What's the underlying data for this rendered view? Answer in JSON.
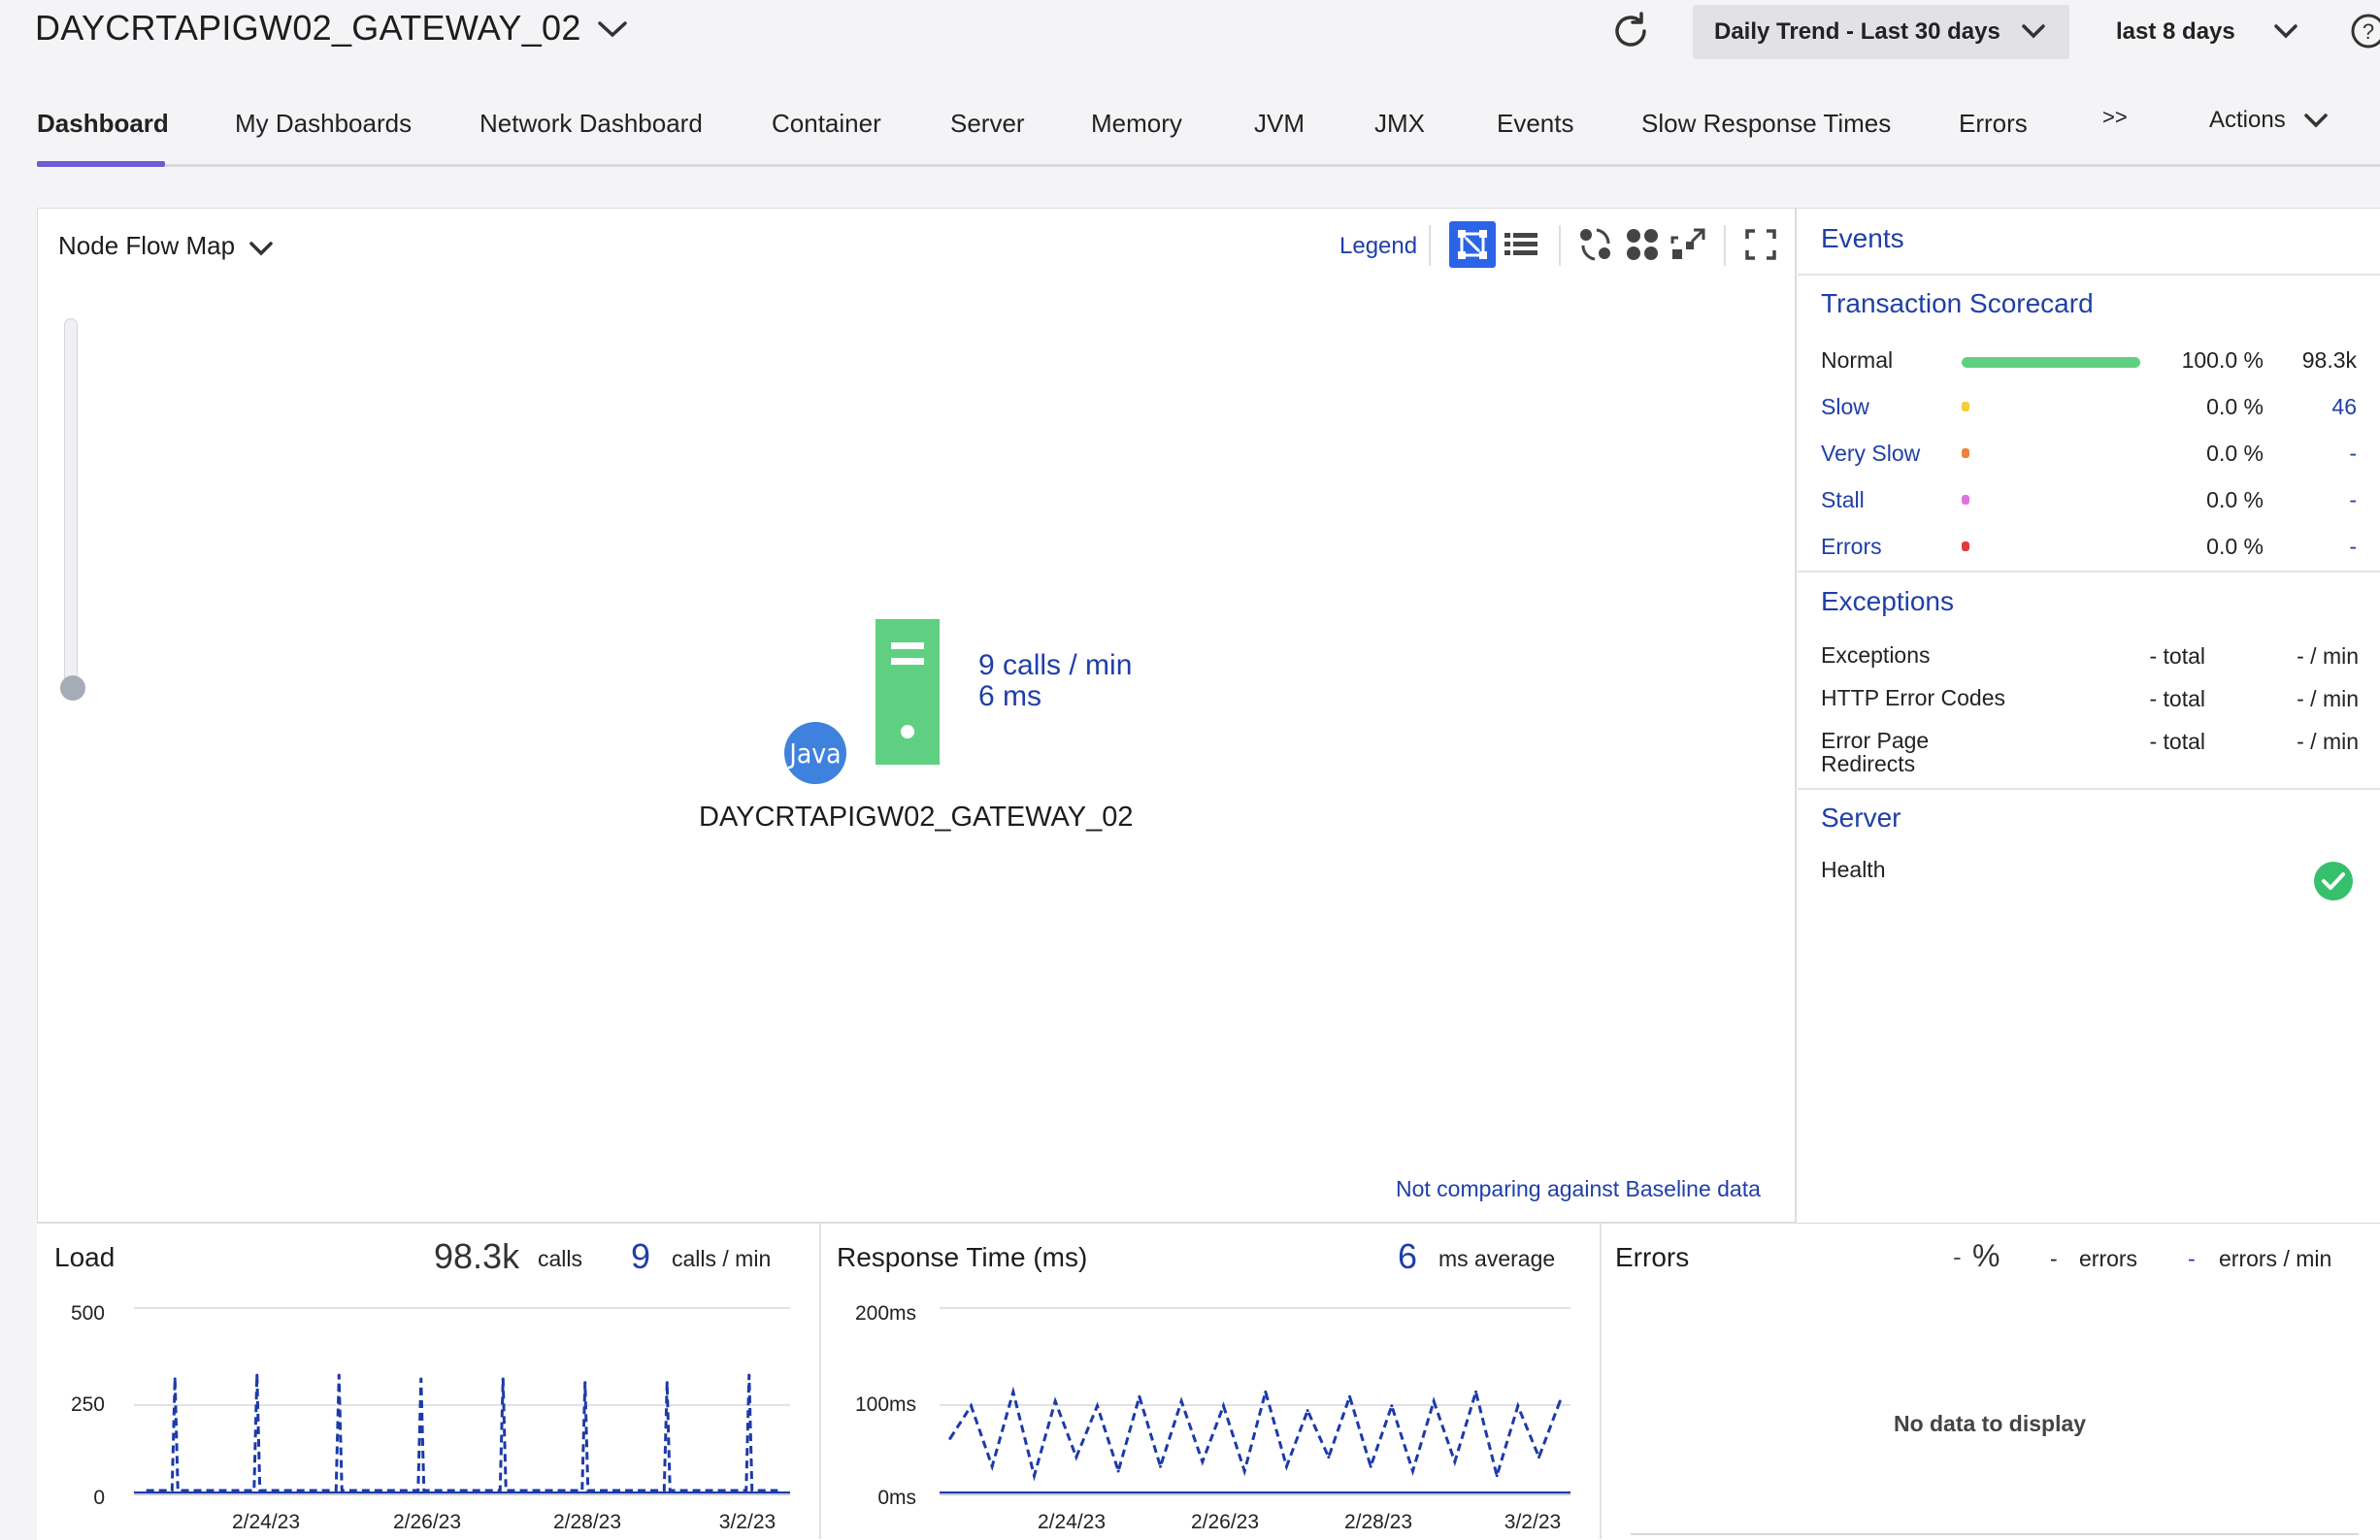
{
  "header": {
    "title": "DAYCRTAPIGW02_GATEWAY_02",
    "trend_label": "Daily Trend - Last 30 days",
    "range_label": "last 8 days"
  },
  "tabs": [
    {
      "label": "Dashboard",
      "active": true
    },
    {
      "label": "My Dashboards"
    },
    {
      "label": "Network Dashboard"
    },
    {
      "label": "Container"
    },
    {
      "label": "Server"
    },
    {
      "label": "Memory"
    },
    {
      "label": "JVM"
    },
    {
      "label": "JMX"
    },
    {
      "label": "Events"
    },
    {
      "label": "Slow Response Times"
    },
    {
      "label": "Errors"
    },
    {
      "label": ">>"
    },
    {
      "label": "Actions"
    }
  ],
  "flowmap": {
    "title": "Node Flow Map",
    "legend": "Legend",
    "node_calls": "9 calls / min",
    "node_ms": "6 ms",
    "node_badge": "Java",
    "node_name": "DAYCRTAPIGW02_GATEWAY_02",
    "baseline_note": "Not comparing against Baseline data",
    "zoom_level": 0
  },
  "events_panel": {
    "events_title": "Events",
    "scorecard_title": "Transaction Scorecard",
    "scorecard": [
      {
        "label": "Normal",
        "pct": "100.0 %",
        "count": "98.3k",
        "color": "#5fd082"
      },
      {
        "label": "Slow",
        "pct": "0.0 %",
        "count": "46",
        "color": "#f4cd3a"
      },
      {
        "label": "Very Slow",
        "pct": "0.0 %",
        "count": "-",
        "color": "#f07f3a"
      },
      {
        "label": "Stall",
        "pct": "0.0 %",
        "count": "-",
        "color": "#e270e0"
      },
      {
        "label": "Errors",
        "pct": "0.0 %",
        "count": "-",
        "color": "#e23a3a"
      }
    ],
    "exceptions_title": "Exceptions",
    "exceptions": [
      {
        "label": "Exceptions",
        "total": "- total",
        "per_min": "- / min"
      },
      {
        "label": "HTTP Error Codes",
        "total": "- total",
        "per_min": "- / min"
      },
      {
        "label": "Error Page Redirects",
        "total": "- total",
        "per_min": "- / min"
      }
    ],
    "server_title": "Server",
    "health_label": "Health",
    "health_status": "ok"
  },
  "load": {
    "title": "Load",
    "total": "98.3k",
    "total_unit": "calls",
    "rate": "9",
    "rate_unit": "calls / min",
    "y_ticks": [
      "500",
      "250",
      "0"
    ],
    "x_ticks": [
      "2/24/23",
      "2/26/23",
      "2/28/23",
      "3/2/23"
    ]
  },
  "response": {
    "title": "Response Time (ms)",
    "avg": "6",
    "avg_unit": "ms average",
    "y_ticks": [
      "200ms",
      "100ms",
      "0ms"
    ],
    "x_ticks": [
      "2/24/23",
      "2/26/23",
      "2/28/23",
      "3/2/23"
    ]
  },
  "errors": {
    "title": "Errors",
    "pct": "-",
    "pct_unit": "%",
    "count": "-",
    "count_unit": "errors",
    "rate": "-",
    "rate_unit": "errors / min",
    "empty": "No data to display"
  },
  "colors": {
    "accent": "#6f5bd3",
    "link": "#1f3fa8",
    "node_green": "#5fd082",
    "java_blue": "#3f82dd",
    "series": "#1c3aa8"
  },
  "chart_data": [
    {
      "type": "line",
      "title": "Load",
      "x": [
        "2/23/23",
        "2/24/23",
        "2/25/23",
        "2/26/23",
        "2/27/23",
        "2/28/23",
        "3/1/23",
        "3/2/23"
      ],
      "series": [
        {
          "values": [
            310,
            320,
            320,
            310,
            310,
            300,
            300,
            320
          ]
        }
      ],
      "ylim": [
        0,
        500
      ],
      "x_tick_labels": [
        "2/24/23",
        "2/26/23",
        "2/28/23",
        "3/2/23"
      ]
    },
    {
      "type": "line",
      "title": "Response Time (ms)",
      "series": [
        {
          "values": [
            60,
            95,
            30,
            110,
            20,
            100,
            40,
            95,
            25,
            105,
            30,
            100,
            35,
            95,
            25,
            110,
            30,
            90,
            40,
            105,
            30,
            95,
            25,
            100,
            35,
            110,
            20,
            95,
            40,
            100
          ]
        }
      ],
      "ylim": [
        0,
        200
      ],
      "x_tick_labels": [
        "2/24/23",
        "2/26/23",
        "2/28/23",
        "3/2/23"
      ]
    }
  ]
}
